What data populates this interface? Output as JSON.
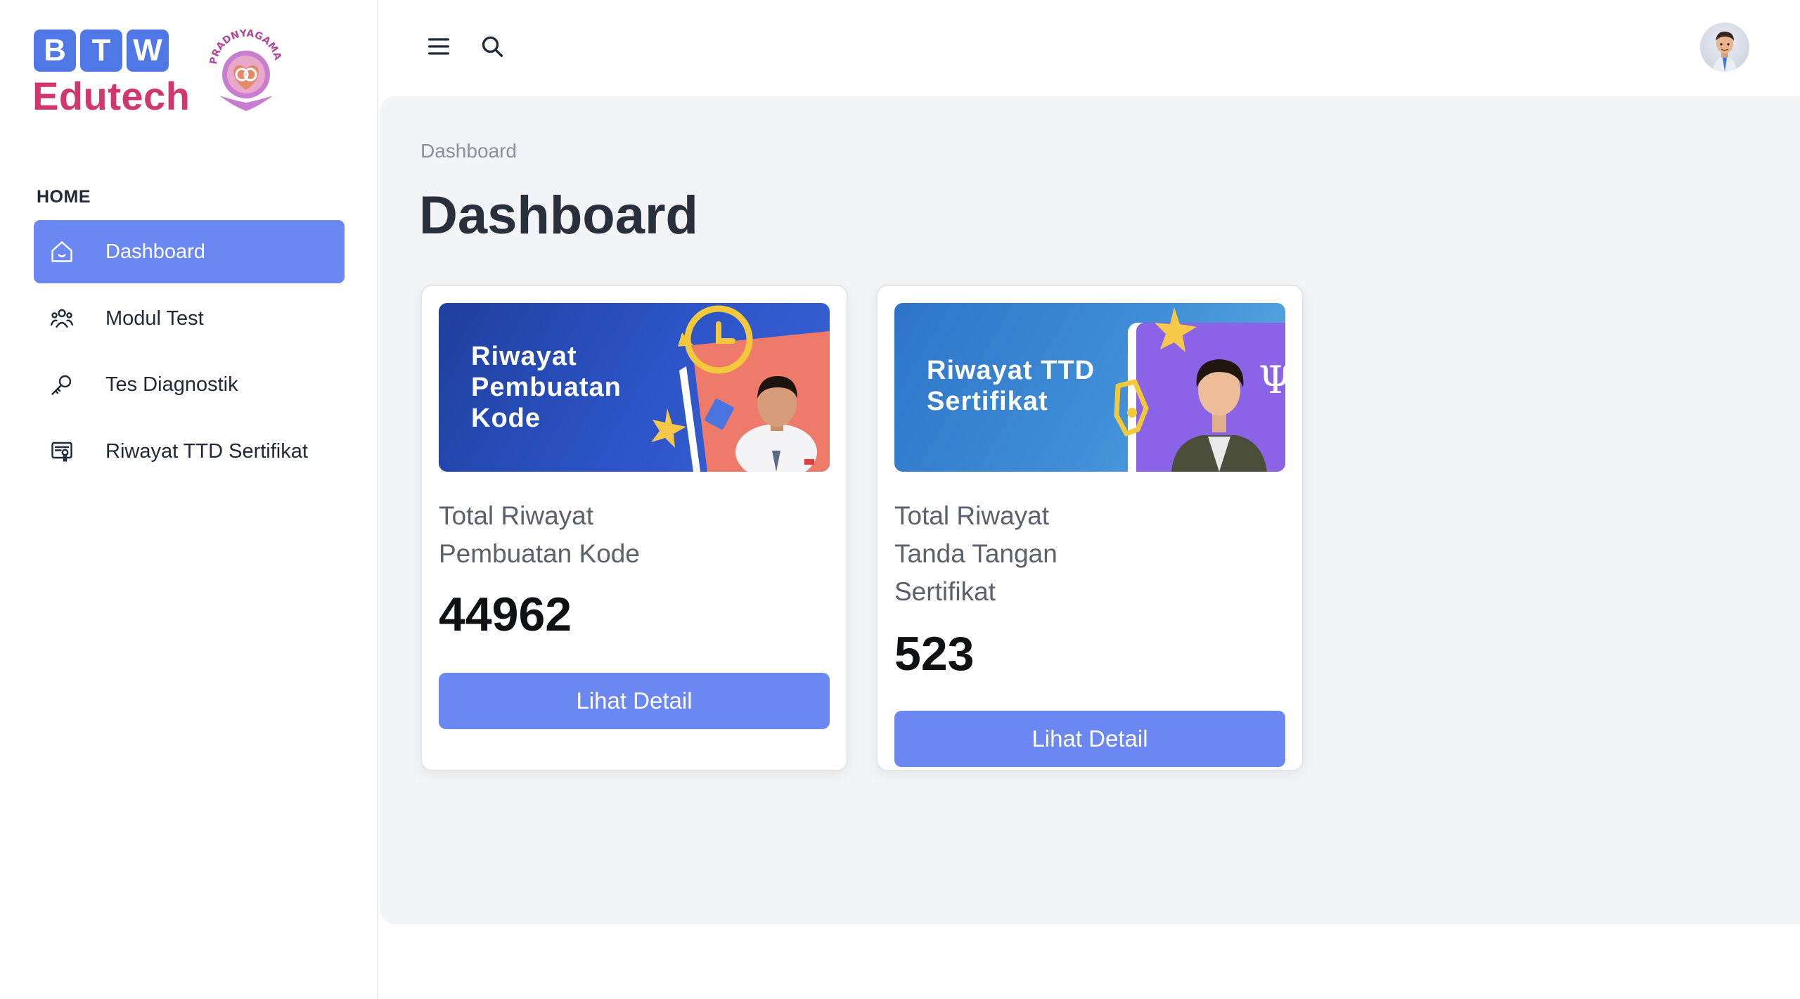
{
  "brand": {
    "logo_letters": [
      "B",
      "T",
      "W"
    ],
    "logo_word": "Edutech",
    "seal_text": "PRADNYAGAMA",
    "accent_blue": "#4f78e6",
    "accent_pink": "#d0386d"
  },
  "sidebar": {
    "section": "HOME",
    "items": [
      {
        "label": "Dashboard",
        "icon": "home-icon",
        "active": true
      },
      {
        "label": "Modul Test",
        "icon": "users-icon",
        "active": false
      },
      {
        "label": "Tes Diagnostik",
        "icon": "key-icon",
        "active": false
      },
      {
        "label": "Riwayat TTD Sertifikat",
        "icon": "certificate-icon",
        "active": false
      }
    ]
  },
  "topbar": {
    "menu_icon": "hamburger-menu-icon",
    "search_icon": "search-icon",
    "avatar_icon": "user-avatar"
  },
  "main": {
    "breadcrumb": "Dashboard",
    "title": "Dashboard",
    "cards": [
      {
        "banner_title": "Riwayat\nPembuatan\nKode",
        "label": "Total Riwayat\nPembuatan Kode",
        "value": "44962",
        "button": "Lihat Detail"
      },
      {
        "banner_title": "Riwayat TTD\nSertifikat",
        "label": "Total Riwayat\nTanda Tangan\nSertifikat",
        "value": "523",
        "button": "Lihat Detail"
      }
    ]
  },
  "colors": {
    "primary": "#6a87f2",
    "background": "#f3f4f7"
  }
}
